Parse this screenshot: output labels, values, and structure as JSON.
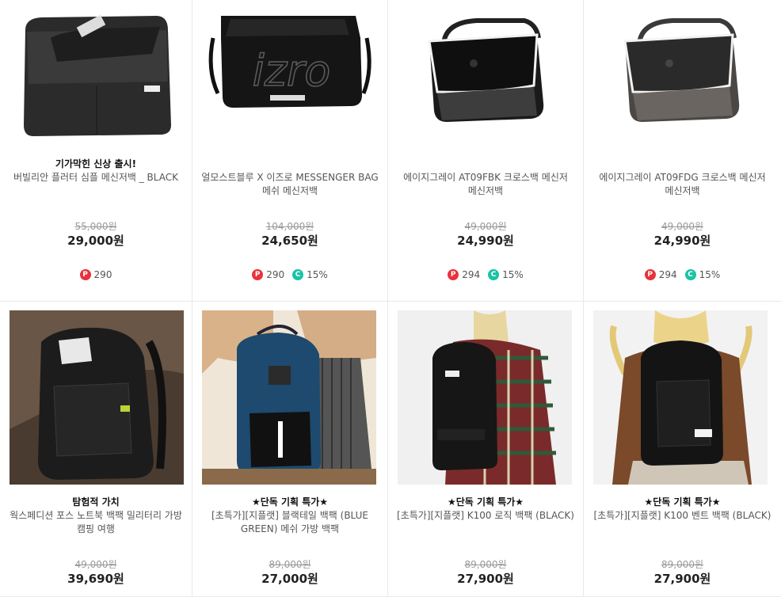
{
  "products": [
    {
      "headline": "기가막힌 신상 출시!",
      "name": "버빌리안 플러터 심플 메신저백 _ BLACK",
      "original_price": "55,000원",
      "price": "29,000원",
      "point": "290",
      "coupon": "",
      "image": "black-messenger-bag"
    },
    {
      "headline": "",
      "name": "얼모스트블루 X 이즈로 MESSENGER BAG 메쉬 메신저백",
      "original_price": "104,000원",
      "price": "24,650원",
      "point": "290",
      "coupon": "15%",
      "image": "black-messenger-bag-izro",
      "logo_text": "izro"
    },
    {
      "headline": "",
      "name": "에이지그레이 AT09FBK 크로스백 메신저 메신저백",
      "original_price": "49,000원",
      "price": "24,990원",
      "point": "294",
      "coupon": "15%",
      "image": "black-crossbody-bag"
    },
    {
      "headline": "",
      "name": "에이지그레이 AT09FDG 크로스백 메신저 메신저백",
      "original_price": "49,000원",
      "price": "24,990원",
      "point": "294",
      "coupon": "15%",
      "image": "darkgray-crossbody-bag"
    },
    {
      "headline": "탐험적 가치",
      "name": "웍스페디션 포스 노트북 백팩 밀리터리 가방 캠핑 여행",
      "original_price": "49,000원",
      "price": "39,690원",
      "image": "black-backpack"
    },
    {
      "headline": "★단독 기획 특가★",
      "name": "[초특가][지플랫] 블랙테일 백팩 (BLUE GREEN) 메쉬 가방 백팩",
      "original_price": "89,000원",
      "price": "27,000원",
      "image": "blue-green-backpack"
    },
    {
      "headline": "★단독 기획 특가★",
      "name": "[초특가][지플랫] K100 로직 백팩 (BLACK)",
      "original_price": "89,000원",
      "price": "27,900원",
      "image": "black-backpack-model"
    },
    {
      "headline": "★단독 기획 특가★",
      "name": "[초특가][지플랫] K100 벤트 백팩 (BLACK)",
      "original_price": "89,000원",
      "price": "27,900원",
      "image": "black-backpack-model-braids"
    }
  ],
  "badge_labels": {
    "point": "P",
    "coupon": "C"
  },
  "colors": {
    "point_badge": "#e8323c",
    "coupon_badge": "#19c3a6",
    "border": "#e9e9e9"
  }
}
